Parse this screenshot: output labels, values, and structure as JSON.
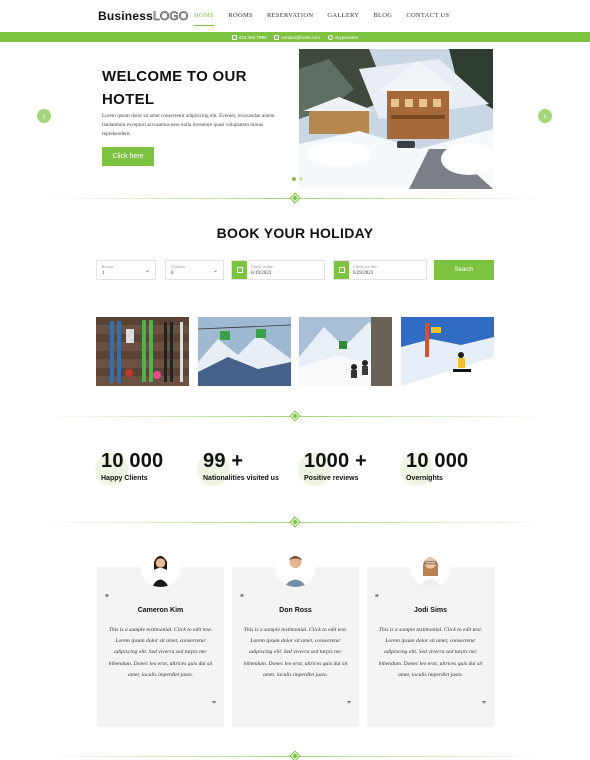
{
  "header": {
    "logo_bold": "Business",
    "logo_light": "LOGO",
    "nav": [
      "HOME",
      "ROOMS",
      "RESERVATION",
      "GALLERY",
      "BLOG",
      "CONTACT US"
    ]
  },
  "topbar": {
    "phone": "023 456 7890",
    "email": "contact@hotel.com",
    "skype": "skypename"
  },
  "hero": {
    "title": "WELCOME TO OUR HOTEL",
    "text": "Lorem ipsum dolor sit amet consectetur adipisicing elit. Eveniet, recusandae autem laudantium excepturi accusamus esse nulla inventore quasi voluptatem minus reprehenderit.",
    "button": "Click here"
  },
  "booking": {
    "title": "BOOK YOUR HOLIDAY",
    "rooms_label": "Rooms",
    "rooms_value": "1",
    "children_label": "Children",
    "children_value": "0",
    "checkin_label": "Check-in date",
    "checkin_value": "6/19/2023",
    "checkout_label": "Check-out date",
    "checkout_value": "6/29/2023",
    "search": "Search"
  },
  "stats": [
    {
      "number": "10 000",
      "label": "Happy Clients"
    },
    {
      "number": "99 +",
      "label": "Nationalities visited us"
    },
    {
      "number": "1000 +",
      "label": "Positive reviews"
    },
    {
      "number": "10 000",
      "label": "Overnights"
    }
  ],
  "testimonials": [
    {
      "name": "Cameron Kim",
      "text": "This is a sample testimonial. Click to edit text. Lorem ipsum dolor sit amet, consectetur adipiscing elit. Sed viverra sed turpis nec bibendum. Donec leo erat, ultrices quis dui sit amet, iaculis imperdiet justo."
    },
    {
      "name": "Don Ross",
      "text": "This is a sample testimonial. Click to edit text. Lorem ipsum dolor sit amet, consectetur adipiscing elit. Sed viverra sed turpis nec bibendum. Donec leo erat, ultrices quis dui sit amet, iaculis imperdiet justo."
    },
    {
      "name": "Jodi Sims",
      "text": "This is a sample testimonial. Click to edit text. Lorem ipsum dolor sit amet, consectetur adipiscing elit. Sed viverra sed turpis nec bibendum. Donec leo erat, ultrices quis dui sit amet, iaculis imperdiet justo."
    }
  ],
  "quote_open": "“",
  "quote_close": "”",
  "arrows": {
    "prev": "‹",
    "next": "›"
  },
  "colors": {
    "accent": "#7dc241"
  }
}
